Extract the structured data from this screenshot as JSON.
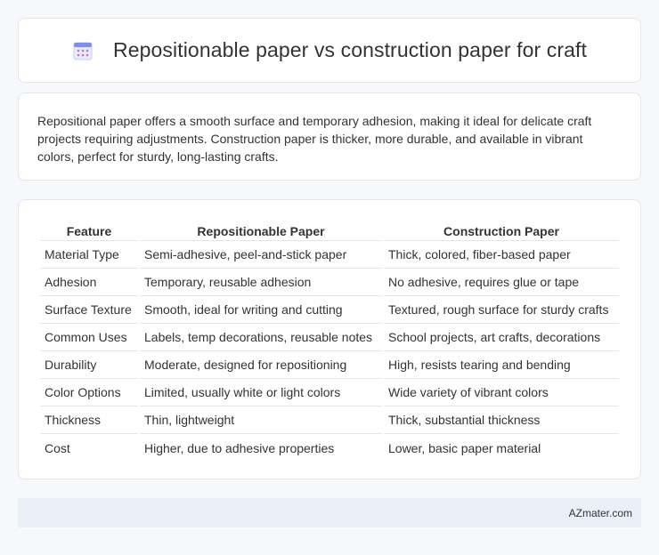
{
  "header": {
    "title": "Repositionable paper vs construction paper for craft",
    "icon": "calendar-icon",
    "accent": "#7b8ff0"
  },
  "summary": {
    "text": "Repositional paper offers a smooth surface and temporary adhesion, making it ideal for delicate craft projects requiring adjustments. Construction paper is thicker, more durable, and available in vibrant colors, perfect for sturdy, long-lasting crafts."
  },
  "table": {
    "headers": [
      "Feature",
      "Repositionable Paper",
      "Construction Paper"
    ],
    "rows": [
      [
        "Material Type",
        "Semi-adhesive, peel-and-stick paper",
        "Thick, colored, fiber-based paper"
      ],
      [
        "Adhesion",
        "Temporary, reusable adhesion",
        "No adhesive, requires glue or tape"
      ],
      [
        "Surface Texture",
        "Smooth, ideal for writing and cutting",
        "Textured, rough surface for sturdy crafts"
      ],
      [
        "Common Uses",
        "Labels, temp decorations, reusable notes",
        "School projects, art crafts, decorations"
      ],
      [
        "Durability",
        "Moderate, designed for repositioning",
        "High, resists tearing and bending"
      ],
      [
        "Color Options",
        "Limited, usually white or light colors",
        "Wide variety of vibrant colors"
      ],
      [
        "Thickness",
        "Thin, lightweight",
        "Thick, substantial thickness"
      ],
      [
        "Cost",
        "Higher, due to adhesive properties",
        "Lower, basic paper material"
      ]
    ]
  },
  "footer": {
    "brand": "AZmater.com"
  }
}
